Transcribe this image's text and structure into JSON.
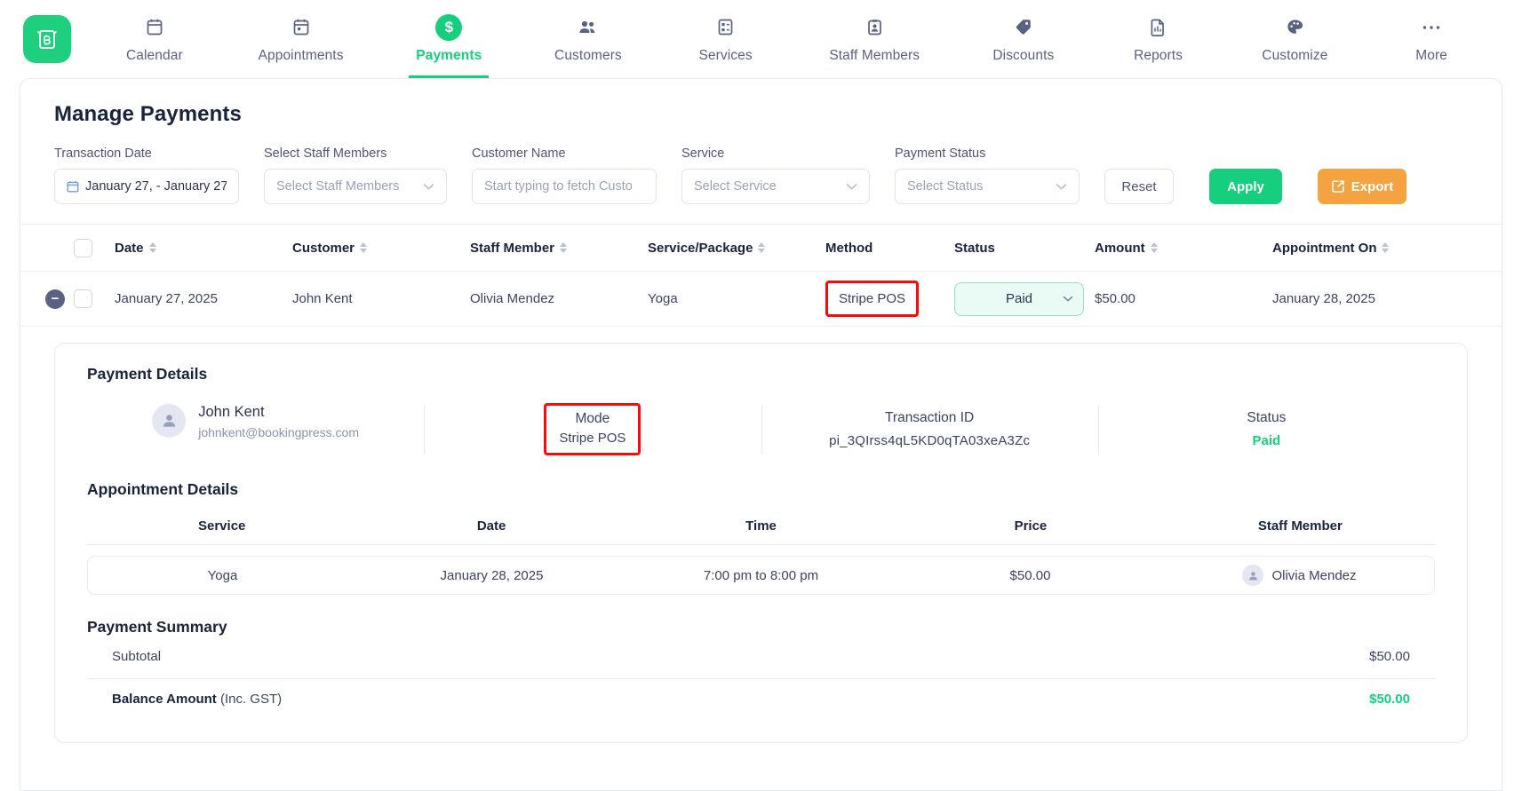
{
  "nav": {
    "brand_icon": "bookingpress-logo-icon",
    "items": [
      {
        "label": "Calendar",
        "icon": "calendar-icon",
        "active": false
      },
      {
        "label": "Appointments",
        "icon": "appointments-icon",
        "active": false
      },
      {
        "label": "Payments",
        "icon": "payments-coin-icon",
        "active": true
      },
      {
        "label": "Customers",
        "icon": "customers-icon",
        "active": false
      },
      {
        "label": "Services",
        "icon": "services-icon",
        "active": false
      },
      {
        "label": "Staff Members",
        "icon": "staff-badge-icon",
        "active": false
      },
      {
        "label": "Discounts",
        "icon": "discount-tag-icon",
        "active": false
      },
      {
        "label": "Reports",
        "icon": "reports-doc-icon",
        "active": false
      },
      {
        "label": "Customize",
        "icon": "palette-icon",
        "active": false
      },
      {
        "label": "More",
        "icon": "ellipsis-icon",
        "active": false
      }
    ]
  },
  "page": {
    "title": "Manage Payments"
  },
  "filters": {
    "transaction_date": {
      "label": "Transaction Date",
      "value": "January 27, -  January 27,"
    },
    "staff": {
      "label": "Select Staff Members",
      "placeholder": "Select Staff Members"
    },
    "customer": {
      "label": "Customer Name",
      "placeholder": "Start typing to fetch Custo"
    },
    "service": {
      "label": "Service",
      "placeholder": "Select Service"
    },
    "status": {
      "label": "Payment Status",
      "placeholder": "Select Status"
    },
    "reset_label": "Reset",
    "apply_label": "Apply",
    "export_label": "Export"
  },
  "table": {
    "columns": [
      {
        "label": "Date",
        "sortable": true
      },
      {
        "label": "Customer",
        "sortable": true
      },
      {
        "label": "Staff Member",
        "sortable": true
      },
      {
        "label": "Service/Package",
        "sortable": true
      },
      {
        "label": "Method",
        "sortable": false
      },
      {
        "label": "Status",
        "sortable": false
      },
      {
        "label": "Amount",
        "sortable": true
      },
      {
        "label": "Appointment On",
        "sortable": true
      }
    ],
    "rows": [
      {
        "date": "January 27, 2025",
        "customer": "John Kent",
        "staff": "Olivia Mendez",
        "service": "Yoga",
        "method": "Stripe POS",
        "status": "Paid",
        "amount": "$50.00",
        "appointment_on": "January 28, 2025",
        "expanded": true
      }
    ]
  },
  "detail": {
    "title": "Payment Details",
    "customer": {
      "name": "John Kent",
      "email": "johnkent@bookingpress.com"
    },
    "mode": {
      "label": "Mode",
      "value": "Stripe POS"
    },
    "transaction": {
      "label": "Transaction ID",
      "value": "pi_3QIrss4qL5KD0qTA03xeA3Zc"
    },
    "status": {
      "label": "Status",
      "value": "Paid"
    },
    "appointment": {
      "title": "Appointment Details",
      "columns": [
        "Service",
        "Date",
        "Time",
        "Price",
        "Staff Member"
      ],
      "row": {
        "service": "Yoga",
        "date": "January 28, 2025",
        "time": "7:00 pm to 8:00 pm",
        "price": "$50.00",
        "staff": "Olivia Mendez"
      }
    },
    "summary": {
      "title": "Payment Summary",
      "subtotal_label": "Subtotal",
      "subtotal_value": "$50.00",
      "total_label": "Balance Amount",
      "total_label_suffix": "(Inc. GST)",
      "total_value": "$50.00"
    }
  },
  "colors": {
    "brand_green": "#15cf7f",
    "export_orange": "#f4a340",
    "highlight_red": "#fb0a0a",
    "nav_text": "#5a6284"
  }
}
